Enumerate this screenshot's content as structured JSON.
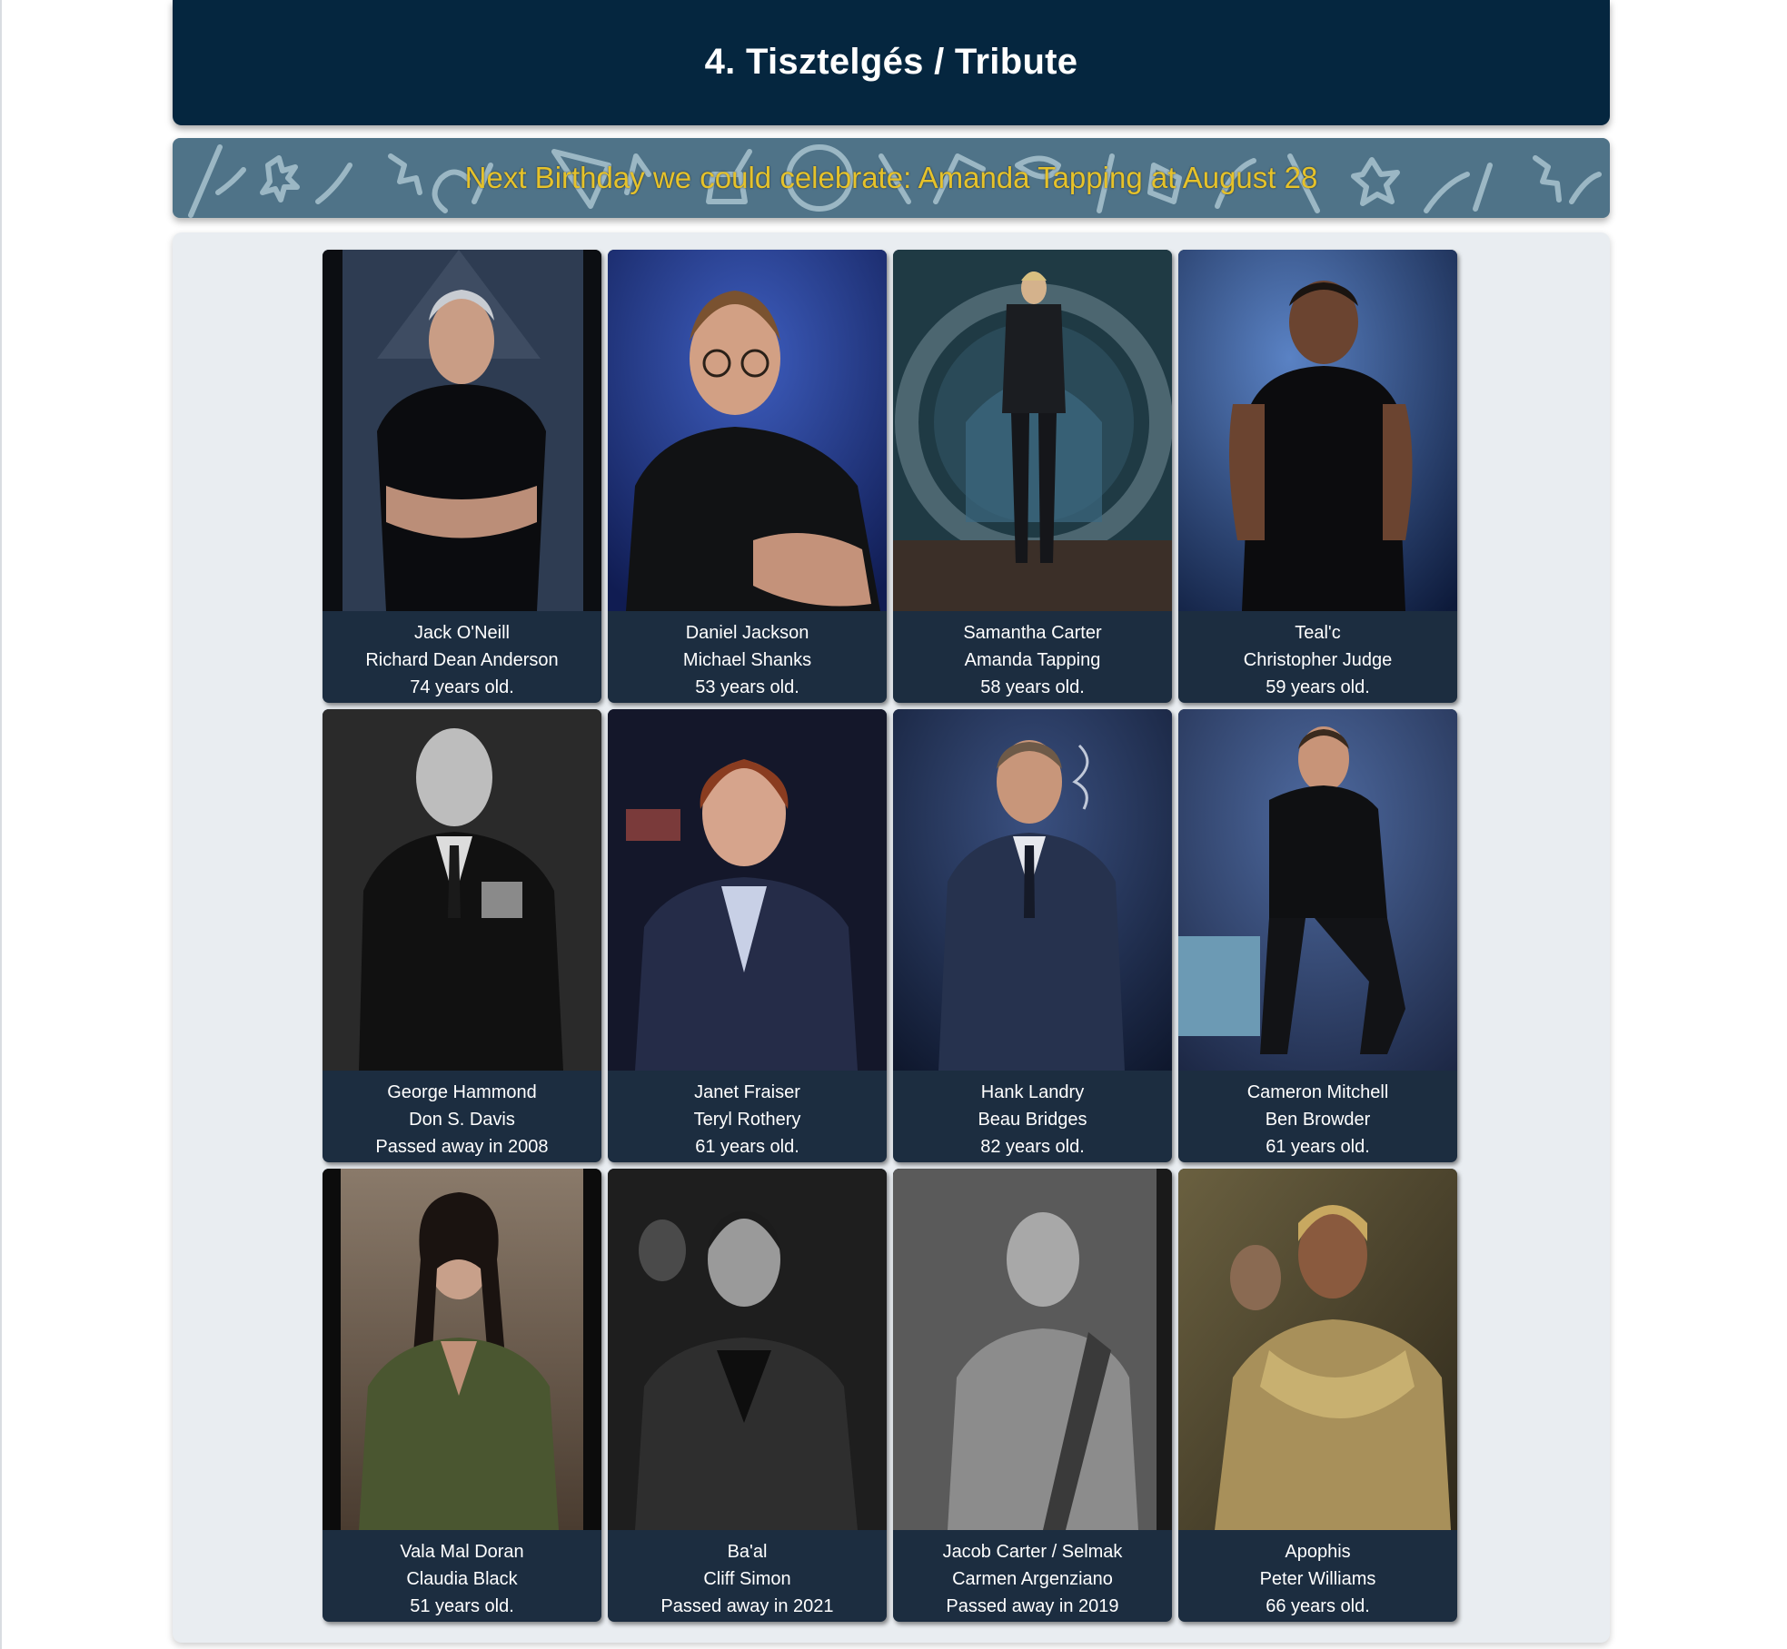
{
  "title": "4. Tisztelgés / Tribute",
  "birthday_banner": "Next Birthday we could celebrate: Amanda Tapping at August 28",
  "cards": [
    {
      "character": "Jack O'Neill",
      "actor": "Richard Dean Anderson",
      "status": "74 years old.",
      "photo": "portrait-photo"
    },
    {
      "character": "Daniel Jackson",
      "actor": "Michael Shanks",
      "status": "53 years old.",
      "photo": "portrait-photo"
    },
    {
      "character": "Samantha Carter",
      "actor": "Amanda Tapping",
      "status": "58 years old.",
      "photo": "portrait-photo"
    },
    {
      "character": "Teal'c",
      "actor": "Christopher Judge",
      "status": "59 years old.",
      "photo": "portrait-photo"
    },
    {
      "character": "George Hammond",
      "actor": "Don S. Davis",
      "status": "Passed away in 2008",
      "photo": "portrait-photo"
    },
    {
      "character": "Janet Fraiser",
      "actor": "Teryl Rothery",
      "status": "61 years old.",
      "photo": "portrait-photo"
    },
    {
      "character": "Hank Landry",
      "actor": "Beau Bridges",
      "status": "82 years old.",
      "photo": "portrait-photo"
    },
    {
      "character": "Cameron Mitchell",
      "actor": "Ben Browder",
      "status": "61 years old.",
      "photo": "portrait-photo"
    },
    {
      "character": "Vala Mal Doran",
      "actor": "Claudia Black",
      "status": "51 years old.",
      "photo": "portrait-photo"
    },
    {
      "character": "Ba'al",
      "actor": "Cliff Simon",
      "status": "Passed away in 2021",
      "photo": "portrait-photo"
    },
    {
      "character": "Jacob Carter / Selmak",
      "actor": "Carmen Argenziano",
      "status": "Passed away in 2019",
      "photo": "portrait-photo"
    },
    {
      "character": "Apophis",
      "actor": "Peter Williams",
      "status": "66 years old.",
      "photo": "portrait-photo"
    }
  ],
  "colors": {
    "title_bar": "#05263f",
    "banner_bg": "#4f7388",
    "banner_text": "#e6c22a",
    "panel_bg": "#e9edf1",
    "caption_bg": "#1c2d40"
  }
}
